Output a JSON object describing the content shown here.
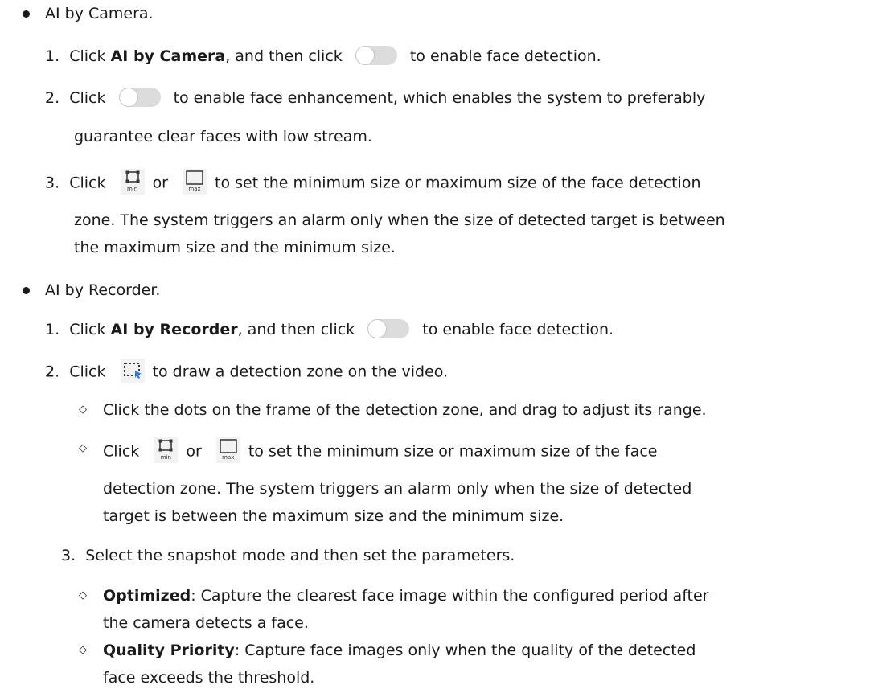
{
  "sections": {
    "camera": {
      "heading": "AI by Camera.",
      "step1": {
        "num": "1.",
        "pre": "Click ",
        "bold": "AI by Camera",
        "mid": ", and then click",
        "post": "to enable face detection."
      },
      "step2": {
        "num": "2.",
        "pre": "Click",
        "post": "to enable face enhancement, which enables the system to preferably",
        "cont": "guarantee clear faces with low stream."
      },
      "step3": {
        "num": "3.",
        "pre": "Click",
        "or": "or",
        "post": "to set the minimum size or maximum size of the face detection",
        "cont1": "zone. The system triggers an alarm only when the size of detected target is between",
        "cont2": "the maximum size and the minimum size."
      }
    },
    "recorder": {
      "heading": "AI by Recorder.",
      "step1": {
        "num": "1.",
        "pre": "Click ",
        "bold": "AI by Recorder",
        "mid": ", and then click",
        "post": "to enable face detection."
      },
      "step2": {
        "num": "2.",
        "pre": "Click",
        "post": "to draw a detection zone on the video.",
        "sub1": "Click the dots on the frame of the detection zone, and drag to adjust its range.",
        "sub2": {
          "pre": "Click",
          "or": "or",
          "post": "to set the minimum size or maximum size of the face",
          "cont1": "detection zone. The system triggers an alarm only when the size of detected",
          "cont2": "target is between the maximum size and the minimum size."
        }
      },
      "step3": {
        "num": "3.",
        "text": "Select the snapshot mode and then set the parameters.",
        "opt1": {
          "bold": "Optimized",
          "text": ": Capture the clearest face image within the configured period after",
          "cont": "the camera detects a face."
        },
        "opt2": {
          "bold": "Quality Priority",
          "text": ": Capture face images only when the quality of the detected",
          "cont": "face exceeds the threshold."
        }
      }
    }
  },
  "icons": {
    "min_label": "min",
    "max_label": "max",
    "diamond": "◇"
  }
}
